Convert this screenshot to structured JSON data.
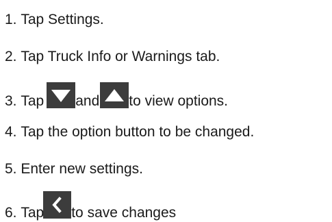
{
  "steps": [
    {
      "num": "1.",
      "text": "Tap Settings."
    },
    {
      "num": "2.",
      "text": "Tap Truck Info or Warnings tab."
    },
    {
      "num": "3.",
      "before": "Tap",
      "middle": "and",
      "after": "to view options.",
      "icons": [
        "chevron-down-icon",
        "chevron-up-icon"
      ]
    },
    {
      "num": "4.",
      "text": "Tap the option button to be changed."
    },
    {
      "num": "5.",
      "text": "Enter new settings."
    },
    {
      "num": "6.",
      "before": "Tap",
      "after": "to save changes",
      "icons": [
        "back-arrow-icon"
      ]
    }
  ],
  "colors": {
    "text": "#1a1a1a",
    "icon_bg": "#3c3c3c",
    "icon_glyph": "#ffffff"
  }
}
